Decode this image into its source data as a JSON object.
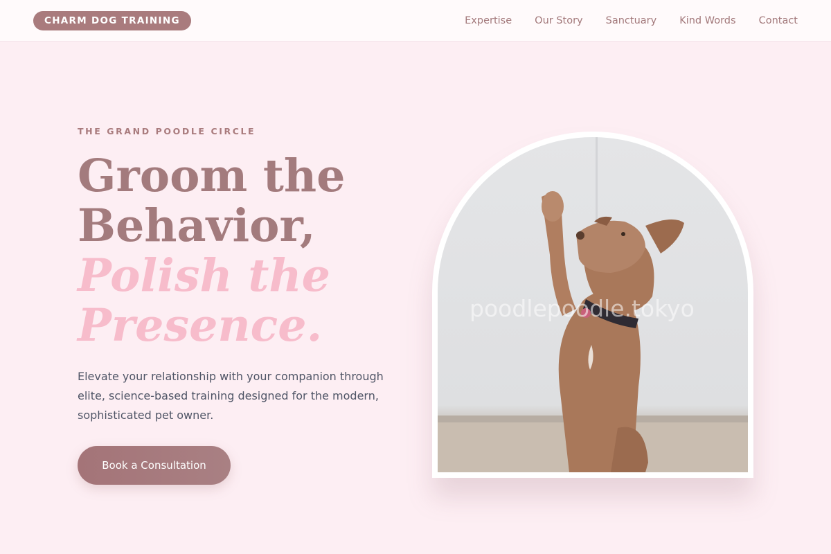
{
  "brand": {
    "logo_text": "CHARM DOG TRAINING",
    "colors": {
      "accent": "#a97b7d",
      "pink": "#f7bccb",
      "background": "#fdeef3"
    }
  },
  "nav": {
    "items": [
      {
        "label": "Expertise"
      },
      {
        "label": "Our Story"
      },
      {
        "label": "Sanctuary"
      },
      {
        "label": "Kind Words"
      },
      {
        "label": "Contact"
      }
    ]
  },
  "hero": {
    "eyebrow": "THE GRAND POODLE CIRCLE",
    "headline_line1": "Groom the",
    "headline_line2": "Behavior,",
    "headline_line3": "Polish the",
    "headline_line4": "Presence.",
    "lead": "Elevate your relationship with your companion through elite, science-based training designed for the modern, sophisticated pet owner.",
    "cta_label": "Book a Consultation"
  },
  "image": {
    "watermark": "poodlepoodle.tokyo"
  }
}
